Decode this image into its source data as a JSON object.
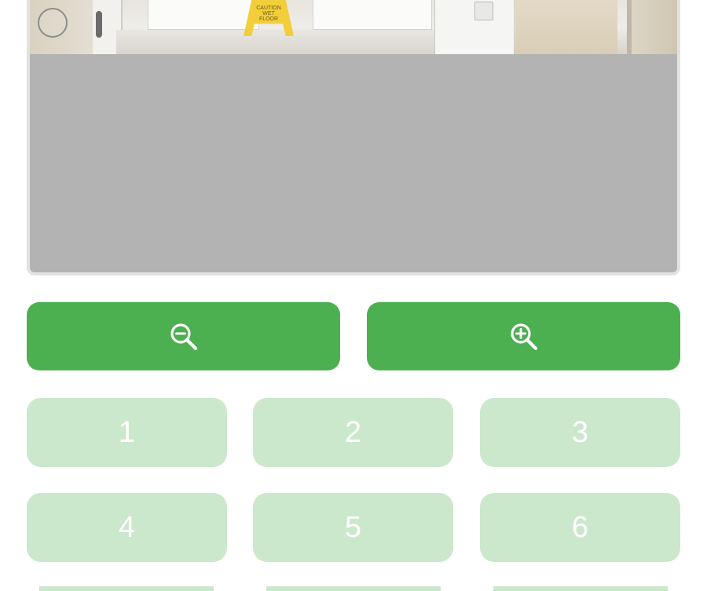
{
  "camera_view": {
    "sign_text": "CAUTION WET FLOOR",
    "marker_icon": "circle-outline"
  },
  "zoom": {
    "out_icon": "zoom-out-icon",
    "in_icon": "zoom-in-icon"
  },
  "keypad": {
    "keys": [
      "1",
      "2",
      "3",
      "4",
      "5",
      "6"
    ]
  },
  "colors": {
    "primary": "#4caf50",
    "keypad_disabled": "#cbe8cc",
    "image_placeholder": "#b3b3b3"
  }
}
